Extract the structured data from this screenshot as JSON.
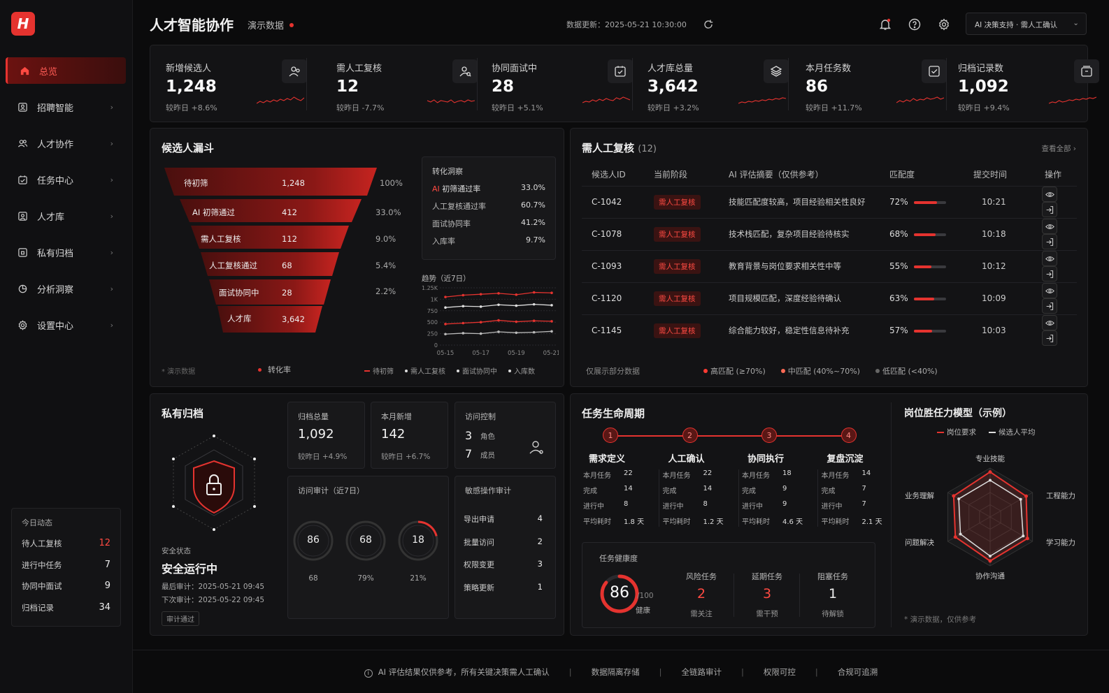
{
  "app": {
    "logo_letter": "H",
    "title": "人才智能协作",
    "subtitle": "演示数据",
    "updated": "数据更新：2025-05-21 10:30:00",
    "mode_select": "AI 决策支持 · 需人工确认"
  },
  "colors": {
    "accent": "#e5332f",
    "bg": "#0b0b0c",
    "panel": "#131315"
  },
  "sidebar": {
    "items": [
      {
        "label": "总览",
        "icon": "home-icon",
        "active": true
      },
      {
        "label": "招聘智能",
        "icon": "resume-icon"
      },
      {
        "label": "人才协作",
        "icon": "users-icon"
      },
      {
        "label": "任务中心",
        "icon": "calendar-check-icon"
      },
      {
        "label": "人才库",
        "icon": "contact-icon"
      },
      {
        "label": "私有归档",
        "icon": "archive-icon"
      },
      {
        "label": "分析洞察",
        "icon": "pie-icon"
      },
      {
        "label": "设置中心",
        "icon": "gear-icon"
      }
    ],
    "today": {
      "title": "今日动态",
      "rows": [
        {
          "label": "待人工复核",
          "value": "12"
        },
        {
          "label": "进行中任务",
          "value": "7"
        },
        {
          "label": "协同中面试",
          "value": "9"
        },
        {
          "label": "归档记录",
          "value": "34"
        }
      ]
    }
  },
  "kpis": [
    {
      "label": "新增候选人",
      "value": "1,248",
      "sub": "较昨日 +8.6%",
      "icon": "user-group-icon"
    },
    {
      "label": "需人工复核",
      "value": "12",
      "sub": "较昨日 -7.7%",
      "icon": "user-search-icon"
    },
    {
      "label": "协同面试中",
      "value": "28",
      "sub": "较昨日 +5.1%",
      "icon": "calendar-icon"
    },
    {
      "label": "人才库总量",
      "value": "3,642",
      "sub": "较昨日 +3.2%",
      "icon": "layers-icon"
    },
    {
      "label": "本月任务数",
      "value": "86",
      "sub": "较昨日 +11.7%",
      "icon": "checkbox-icon"
    },
    {
      "label": "归档记录数",
      "value": "1,092",
      "sub": "较昨日 +9.4%",
      "icon": "archive-box-icon"
    }
  ],
  "funnel": {
    "title": "候选人漏斗",
    "stages": [
      {
        "label": "待初筛",
        "value": "1,248",
        "pct": "100%"
      },
      {
        "label": "AI 初筛通过",
        "value": "412",
        "pct": "33.0%"
      },
      {
        "label": "需人工复核",
        "value": "112",
        "pct": "9.0%"
      },
      {
        "label": "人工复核通过",
        "value": "68",
        "pct": "5.4%"
      },
      {
        "label": "面试协同中",
        "value": "28",
        "pct": "2.2%"
      },
      {
        "label": "人才库",
        "value": "3,642",
        "pct": ""
      }
    ],
    "insight_title": "转化洞察",
    "insights": [
      {
        "label": "AI 初筛通过率",
        "value": "33.0%"
      },
      {
        "label": "人工复核通过率",
        "value": "60.7%"
      },
      {
        "label": "面试协同率",
        "value": "41.2%"
      },
      {
        "label": "入库率",
        "value": "9.7%"
      }
    ],
    "trend_title": "趋势（近7日）",
    "footnote": "* 演示数据",
    "rate_legend": "转化率",
    "legend": [
      "待初筛",
      "需人工复核",
      "面试协同中",
      "入库数"
    ]
  },
  "chart_data": {
    "type": "line",
    "x": [
      "05-15",
      "05-16",
      "05-17",
      "05-18",
      "05-19",
      "05-20",
      "05-21"
    ],
    "x_ticks": [
      "05-15",
      "05-17",
      "05-19",
      "05-21"
    ],
    "y_ticks": [
      "1.25K",
      "1K",
      "750",
      "500",
      "250",
      "0"
    ],
    "ylim": [
      0,
      1250
    ],
    "series": [
      {
        "name": "待初筛",
        "values": [
          1050,
          1090,
          1110,
          1130,
          1100,
          1150,
          1140
        ],
        "color": "#e5332f"
      },
      {
        "name": "需人工复核",
        "values": [
          820,
          850,
          840,
          880,
          860,
          890,
          870
        ],
        "color": "#dddddd"
      },
      {
        "name": "面试协同中",
        "values": [
          460,
          480,
          500,
          540,
          510,
          530,
          520
        ],
        "color": "#e5332f"
      },
      {
        "name": "入库数",
        "values": [
          240,
          260,
          250,
          290,
          270,
          280,
          300
        ],
        "color": "#bbbbbb"
      }
    ]
  },
  "review": {
    "title": "需人工复核",
    "count": "(12)",
    "view_all": "查看全部 ›",
    "columns": [
      "候选人ID",
      "当前阶段",
      "AI 评估摘要（仅供参考）",
      "匹配度",
      "提交时间",
      "操作"
    ],
    "rows": [
      {
        "id": "C-1042",
        "stage": "需人工复核",
        "summary": "技能匹配度较高，项目经验相关性良好",
        "match": "72%",
        "match_v": 72,
        "time": "10:21"
      },
      {
        "id": "C-1078",
        "stage": "需人工复核",
        "summary": "技术栈匹配，复杂项目经验待核实",
        "match": "68%",
        "match_v": 68,
        "time": "10:18"
      },
      {
        "id": "C-1093",
        "stage": "需人工复核",
        "summary": "教育背景与岗位要求相关性中等",
        "match": "55%",
        "match_v": 55,
        "time": "10:12"
      },
      {
        "id": "C-1120",
        "stage": "需人工复核",
        "summary": "项目规模匹配，深度经验待确认",
        "match": "63%",
        "match_v": 63,
        "time": "10:09"
      },
      {
        "id": "C-1145",
        "stage": "需人工复核",
        "summary": "综合能力较好，稳定性信息待补充",
        "match": "57%",
        "match_v": 57,
        "time": "10:03"
      }
    ],
    "footnote": "仅展示部分数据",
    "legend": [
      "高匹配 (≥70%)",
      "中匹配 (40%~70%)",
      "低匹配 (<40%)"
    ]
  },
  "archive": {
    "title": "私有归档",
    "status_label": "安全状态",
    "status": "安全运行中",
    "last_audit": "最后审计：2025-05-21 09:45",
    "next_audit": "下次审计：2025-05-22 09:45",
    "audit_badge": "审计通过",
    "total_label": "归档总量",
    "total": "1,092",
    "total_sub": "较昨日 +4.9%",
    "new_label": "本月新增",
    "new": "142",
    "new_sub": "较昨日 +6.7%",
    "access_label": "访问控制",
    "roles": "3",
    "roles_label": "角色",
    "members": "7",
    "members_label": "成员",
    "audit_title": "访问审计（近7日）",
    "rings": [
      {
        "value": "86",
        "caption": "68",
        "fill": 0
      },
      {
        "value": "68",
        "caption": "79%",
        "fill": 0
      },
      {
        "value": "18",
        "caption": "21%",
        "fill": 0.21
      }
    ],
    "sensitive_title": "敏感操作审计",
    "sensitive": [
      {
        "label": "导出申请",
        "value": "4"
      },
      {
        "label": "批量访问",
        "value": "2"
      },
      {
        "label": "权限变更",
        "value": "3"
      },
      {
        "label": "策略更新",
        "value": "1"
      }
    ]
  },
  "lifecycle": {
    "title": "任务生命周期",
    "stages": [
      {
        "n": "1",
        "name": "需求定义",
        "stats": [
          [
            "本月任务",
            "22"
          ],
          [
            "完成",
            "14"
          ],
          [
            "进行中",
            "8"
          ],
          [
            "平均耗时",
            "1.8 天"
          ]
        ]
      },
      {
        "n": "2",
        "name": "人工确认",
        "stats": [
          [
            "本月任务",
            "22"
          ],
          [
            "完成",
            "14"
          ],
          [
            "进行中",
            "8"
          ],
          [
            "平均耗时",
            "1.2 天"
          ]
        ]
      },
      {
        "n": "3",
        "name": "协同执行",
        "stats": [
          [
            "本月任务",
            "18"
          ],
          [
            "完成",
            "9"
          ],
          [
            "进行中",
            "9"
          ],
          [
            "平均耗时",
            "4.6 天"
          ]
        ]
      },
      {
        "n": "4",
        "name": "复盘沉淀",
        "stats": [
          [
            "本月任务",
            "14"
          ],
          [
            "完成",
            "7"
          ],
          [
            "进行中",
            "7"
          ],
          [
            "平均耗时",
            "2.1 天"
          ]
        ]
      }
    ],
    "health_title": "任务健康度",
    "health": "86",
    "health_max": "/100",
    "health_label": "健康",
    "health_fill": 0.86,
    "metrics": [
      {
        "label": "风险任务",
        "value": "2",
        "sub": "需关注",
        "red": true
      },
      {
        "label": "延期任务",
        "value": "3",
        "sub": "需干预",
        "red": true
      },
      {
        "label": "阻塞任务",
        "value": "1",
        "sub": "待解锁",
        "red": false
      }
    ]
  },
  "radar": {
    "title": "岗位胜任力模型（示例）",
    "legend": [
      "岗位要求",
      "候选人平均"
    ],
    "axes": [
      "专业技能",
      "工程能力",
      "学习能力",
      "协作沟通",
      "问题解决",
      "业务理解"
    ],
    "required": [
      0.92,
      0.85,
      0.88,
      0.9,
      0.82,
      0.86
    ],
    "average": [
      0.75,
      0.72,
      0.78,
      0.8,
      0.7,
      0.74
    ],
    "footnote": "* 演示数据，仅供参考"
  },
  "footer": [
    "AI 评估结果仅供参考，所有关键决策需人工确认",
    "数据隔离存储",
    "全链路审计",
    "权限可控",
    "合规可追溯"
  ]
}
